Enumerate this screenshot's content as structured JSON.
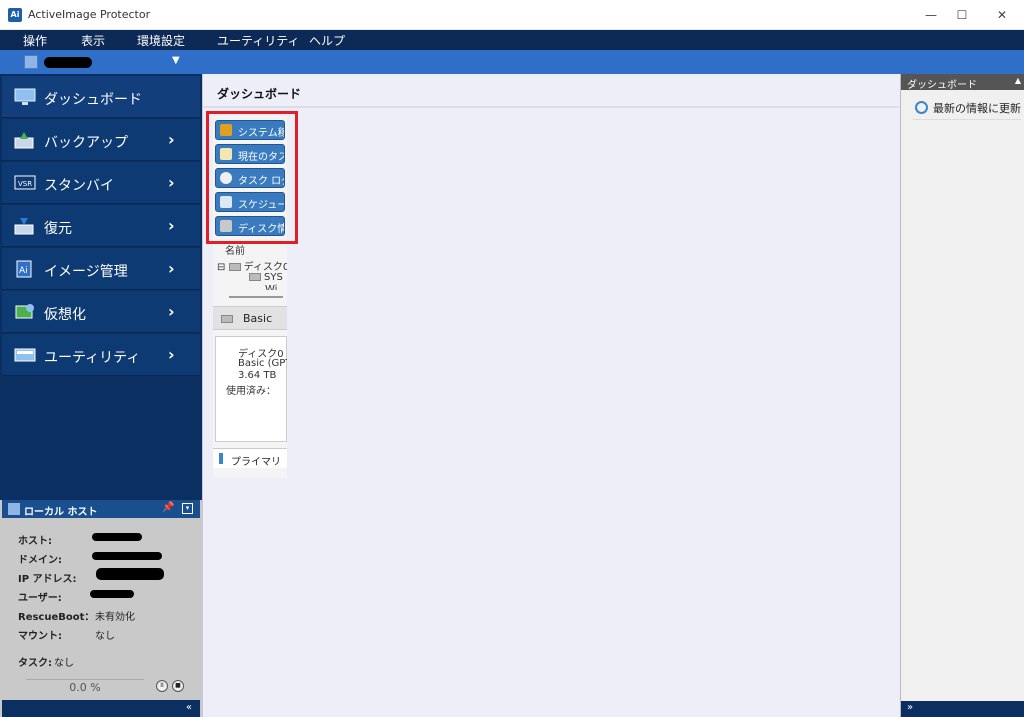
{
  "window": {
    "logo": "Ai",
    "title": "ActiveImage Protector",
    "minimize": "—",
    "maximize": "☐",
    "close": "✕"
  },
  "menu": [
    "操作",
    "表示",
    "環境設定",
    "ユーティリティ",
    "ヘルプ"
  ],
  "hostbar": {
    "dropdown_icon": "▼"
  },
  "sidebar": {
    "chevron": "›",
    "items": [
      {
        "label": "ダッシュボード",
        "icon": "monitor-icon"
      },
      {
        "label": "バックアップ",
        "icon": "backup-icon"
      },
      {
        "label": "スタンバイ",
        "icon": "vsr-icon"
      },
      {
        "label": "復元",
        "icon": "restore-icon"
      },
      {
        "label": "イメージ管理",
        "icon": "image-management-icon"
      },
      {
        "label": "仮想化",
        "icon": "virtualization-icon"
      },
      {
        "label": "ユーティリティ",
        "icon": "utility-icon"
      }
    ]
  },
  "local_host": {
    "title": "ローカル ホスト",
    "pin": "📌",
    "menu": "▾",
    "labels": {
      "host": "ホスト:",
      "domain": "ドメイン:",
      "ip": "IP アドレス:",
      "user": "ユーザー:",
      "rescueboot": "RescueBoot：",
      "mount": "マウント:",
      "task": "タスク:"
    },
    "values": {
      "rescueboot": "未有効化",
      "mount": "なし",
      "task": "なし"
    },
    "progress": "0.0 %",
    "pause": "II",
    "stop": "■",
    "collapse": "«"
  },
  "main": {
    "title": "ダッシュボード",
    "tiles": [
      {
        "label": "システム稼",
        "color": "#e0a020"
      },
      {
        "label": "現在のタス",
        "color": "#f3e6b0"
      },
      {
        "label": "タスク ログ",
        "color": "#f0f0f0"
      },
      {
        "label": "スケジュー",
        "color": "#dde8f5"
      },
      {
        "label": "ディスク情報",
        "color": "#c8c8c8"
      }
    ],
    "tree": {
      "header": "名前",
      "expander": "⊟",
      "root": "ディスク0",
      "child1": "SYS",
      "child2": "Wi"
    },
    "disk": {
      "head": "Basic",
      "name": "ディスク0",
      "type": "Basic (GPT)",
      "size": "3.64 TB",
      "used": "使用済み：",
      "primary": "プライマリ"
    }
  },
  "right_panel": {
    "title": "ダッシュボード",
    "arrow": "▲",
    "refresh": "最新の情報に更新",
    "expand": "»"
  }
}
